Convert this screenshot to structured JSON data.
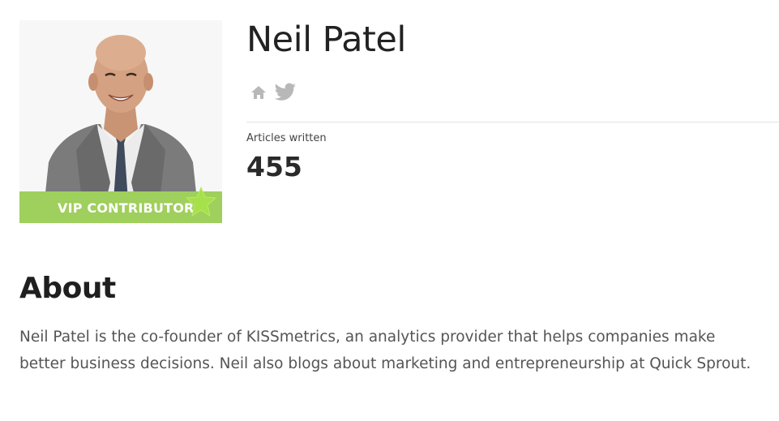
{
  "profile": {
    "name": "Neil Patel",
    "badge_label": "VIP CONTRIBUTOR",
    "badge_icon": "star-icon",
    "photo": "author-headshot"
  },
  "social": [
    {
      "name": "home",
      "icon": "home-icon"
    },
    {
      "name": "twitter",
      "icon": "twitter-icon"
    }
  ],
  "stats": {
    "articles_label": "Articles written",
    "articles_value": "455"
  },
  "about": {
    "heading": "About",
    "text": "Neil Patel is the co-founder of KISSmetrics, an analytics provider that helps companies make better business decisions. Neil also blogs about marketing and entrepreneurship at Quick Sprout."
  },
  "colors": {
    "badge": "#9fcf5c",
    "star": "#a6e04a",
    "icon": "#b8b8b8",
    "divider": "#e4e4e4"
  }
}
